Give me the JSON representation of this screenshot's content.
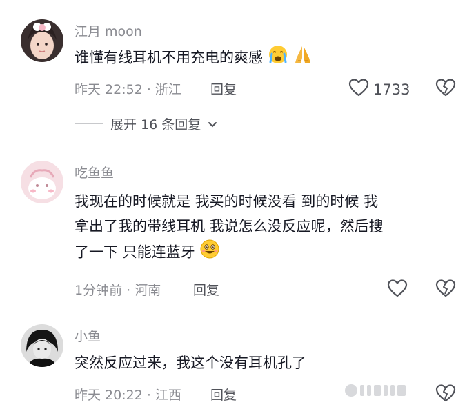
{
  "comments": [
    {
      "author": "江月 moon",
      "text": "谁懂有线耳机不用充电的爽感",
      "time_location": "昨天 22:52 · 浙江",
      "reply_label": "回复",
      "like_count": "1733",
      "emojis": [
        "crying-face",
        "praying-hands"
      ]
    },
    {
      "author": "吃鱼鱼",
      "lines": [
        "我现在的时候就是 我买的时候没看 到的时候 我",
        "拿出了我的带线耳机 我说怎么没反应呢，然后搜",
        "了一下 只能连蓝牙"
      ],
      "time_location": "1分钟前 · 河南",
      "reply_label": "回复",
      "emojis": [
        "grinning-face"
      ]
    },
    {
      "author": "小鱼",
      "text": "突然反应过来，我这个没有耳机孔了",
      "time_location": "昨天 20:22 · 江西",
      "reply_label": "回复"
    }
  ],
  "expand_replies": {
    "label": "展开 16 条回复"
  },
  "icons": [
    "heart-icon",
    "broken-heart-icon",
    "chevron-down-icon"
  ]
}
